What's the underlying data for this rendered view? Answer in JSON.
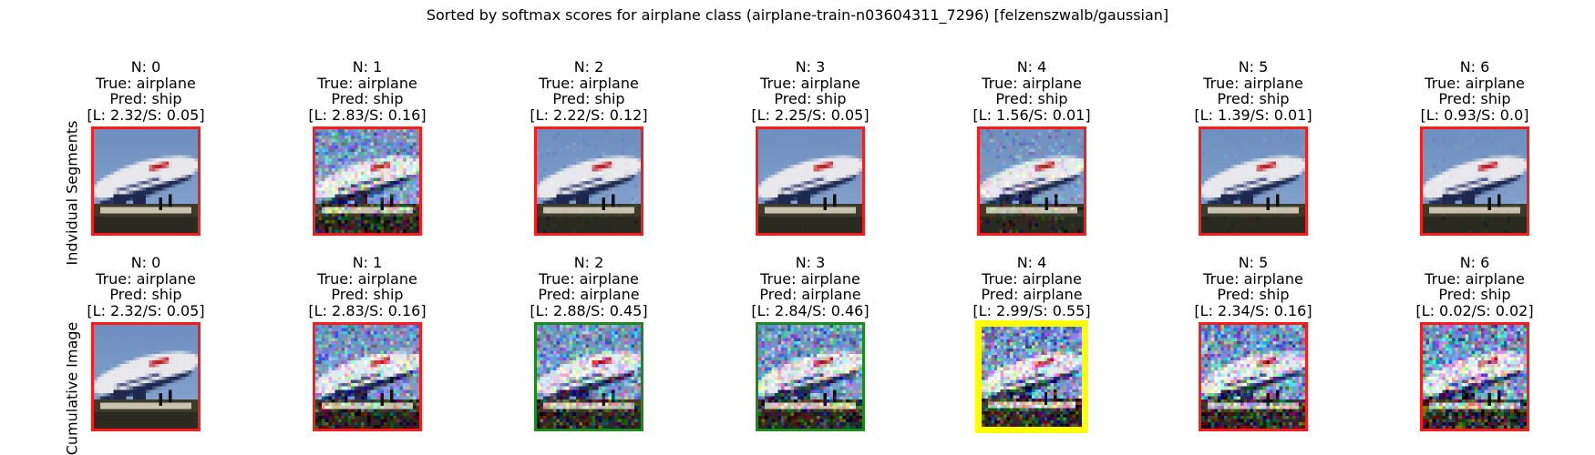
{
  "title": "Sorted by softmax scores for airplane class (airplane-train-n03604311_7296) [felzenszwalb/gaussian]",
  "colors": {
    "red": "#ff1a1a",
    "green": "#1a8a1a",
    "yellow": "#ffff00"
  },
  "rows": [
    {
      "label": "Indvidual Segments",
      "panels": [
        {
          "n": "N: 0",
          "true_label": "True: airplane",
          "pred": "Pred: ship",
          "ls": "[L: 2.32/S: 0.05]",
          "border": "red",
          "noise": 0.0
        },
        {
          "n": "N: 1",
          "true_label": "True: airplane",
          "pred": "Pred: ship",
          "ls": "[L: 2.83/S: 0.16]",
          "border": "red",
          "noise": 0.65
        },
        {
          "n": "N: 2",
          "true_label": "True: airplane",
          "pred": "Pred: ship",
          "ls": "[L: 2.22/S: 0.12]",
          "border": "red",
          "noise": 0.15
        },
        {
          "n": "N: 3",
          "true_label": "True: airplane",
          "pred": "Pred: ship",
          "ls": "[L: 2.25/S: 0.05]",
          "border": "red",
          "noise": 0.05
        },
        {
          "n": "N: 4",
          "true_label": "True: airplane",
          "pred": "Pred: ship",
          "ls": "[L: 1.56/S: 0.01]",
          "border": "red",
          "noise": 0.35
        },
        {
          "n": "N: 5",
          "true_label": "True: airplane",
          "pred": "Pred: ship",
          "ls": "[L: 1.39/S: 0.01]",
          "border": "red",
          "noise": 0.1
        },
        {
          "n": "N: 6",
          "true_label": "True: airplane",
          "pred": "Pred: ship",
          "ls": "[L: 0.93/S: 0.0]",
          "border": "red",
          "noise": 0.12
        }
      ]
    },
    {
      "label": "Cumulative Image",
      "panels": [
        {
          "n": "N: 0",
          "true_label": "True: airplane",
          "pred": "Pred: ship",
          "ls": "[L: 2.32/S: 0.05]",
          "border": "red",
          "noise": 0.0
        },
        {
          "n": "N: 1",
          "true_label": "True: airplane",
          "pred": "Pred: ship",
          "ls": "[L: 2.83/S: 0.16]",
          "border": "red",
          "noise": 0.65
        },
        {
          "n": "N: 2",
          "true_label": "True: airplane",
          "pred": "Pred: airplane",
          "ls": "[L: 2.88/S: 0.45]",
          "border": "green",
          "noise": 0.7
        },
        {
          "n": "N: 3",
          "true_label": "True: airplane",
          "pred": "Pred: airplane",
          "ls": "[L: 2.84/S: 0.46]",
          "border": "green",
          "noise": 0.72
        },
        {
          "n": "N: 4",
          "true_label": "True: airplane",
          "pred": "Pred: airplane",
          "ls": "[L: 2.99/S: 0.55]",
          "border": "yellow",
          "noise": 0.8
        },
        {
          "n": "N: 5",
          "true_label": "True: airplane",
          "pred": "Pred: ship",
          "ls": "[L: 2.34/S: 0.16]",
          "border": "red",
          "noise": 0.82
        },
        {
          "n": "N: 6",
          "true_label": "True: airplane",
          "pred": "Pred: ship",
          "ls": "[L: 0.02/S: 0.02]",
          "border": "red",
          "noise": 0.85
        }
      ]
    }
  ]
}
